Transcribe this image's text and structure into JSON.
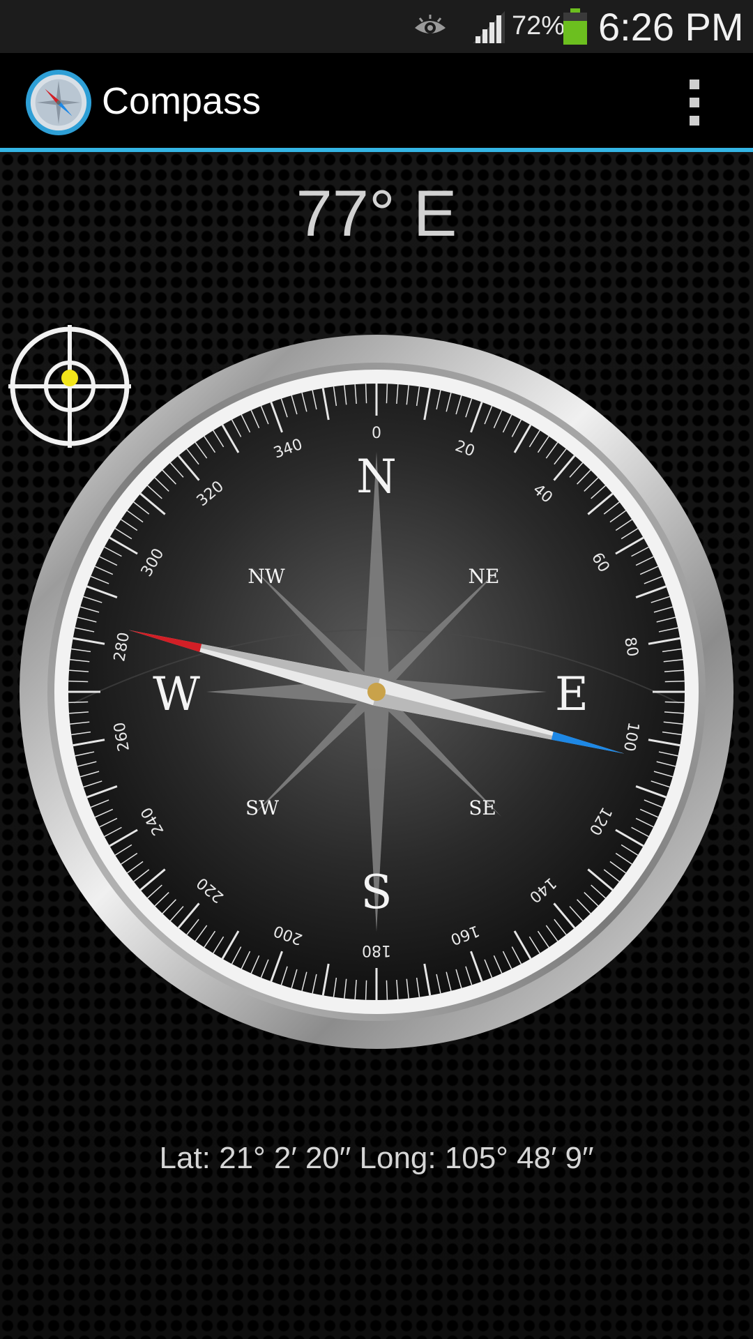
{
  "status_bar": {
    "battery_percent": "72%",
    "time": "6:26 PM",
    "icons": [
      "eye-icon",
      "signal-icon",
      "battery-icon"
    ],
    "battery_color": "#6cbf1f"
  },
  "action_bar": {
    "title": "Compass",
    "accent_color": "#34b5e5",
    "icons": [
      "compass-app-icon",
      "overflow-menu-icon"
    ]
  },
  "heading": {
    "readout": "77° E",
    "degrees": 77
  },
  "compass": {
    "cardinals": [
      "N",
      "E",
      "S",
      "W"
    ],
    "intercardinals": [
      "NE",
      "SE",
      "SW",
      "NW"
    ],
    "dial_numbers": [
      "0",
      "20",
      "40",
      "60",
      "80",
      "100",
      "120",
      "140",
      "160",
      "180",
      "200",
      "220",
      "240",
      "260",
      "280",
      "300",
      "320",
      "340"
    ],
    "needle_north_color": "#d21f26",
    "needle_south_color": "#1e88e5"
  },
  "calibration": {
    "icon": "crosshair-icon"
  },
  "location": {
    "text": "Lat: 21° 2′ 20′′ Long: 105° 48′ 9′′"
  }
}
